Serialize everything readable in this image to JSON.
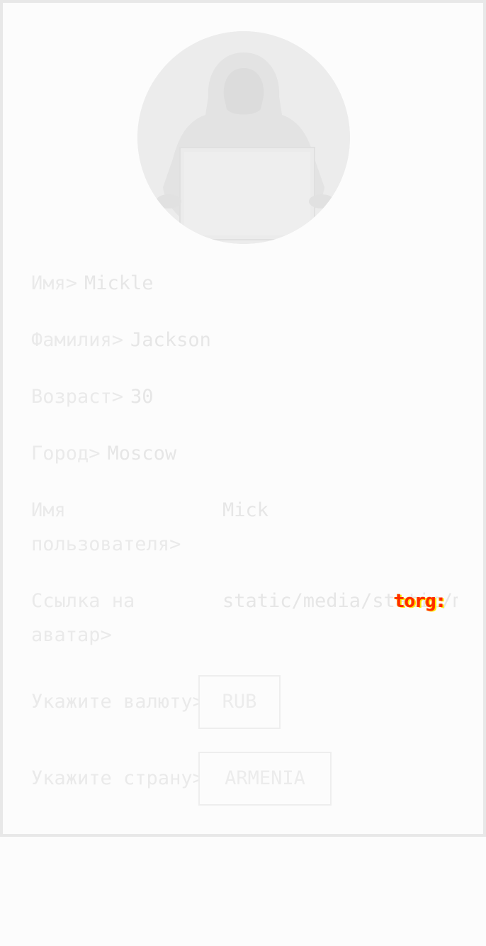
{
  "profile": {
    "avatar_alt": "hooded figure at laptop",
    "fields": {
      "first_name": {
        "label": "Имя>",
        "value": "Mickle"
      },
      "last_name": {
        "label": "Фамилия>",
        "value": "Jackson"
      },
      "age": {
        "label": "Возраст>",
        "value": "30"
      },
      "city": {
        "label": "Город>",
        "value": "Moscow"
      },
      "username": {
        "label": "Имя пользователя>",
        "value": "Mick"
      },
      "avatar_link": {
        "label": "Ссылка на аватар>",
        "value": "static/media/static/media/"
      },
      "currency": {
        "label": "Укажите валюту>",
        "value": "RUB"
      },
      "country": {
        "label": "Укажите страну>",
        "value": "ARMENIA"
      }
    },
    "overlay_text": "torg:"
  }
}
